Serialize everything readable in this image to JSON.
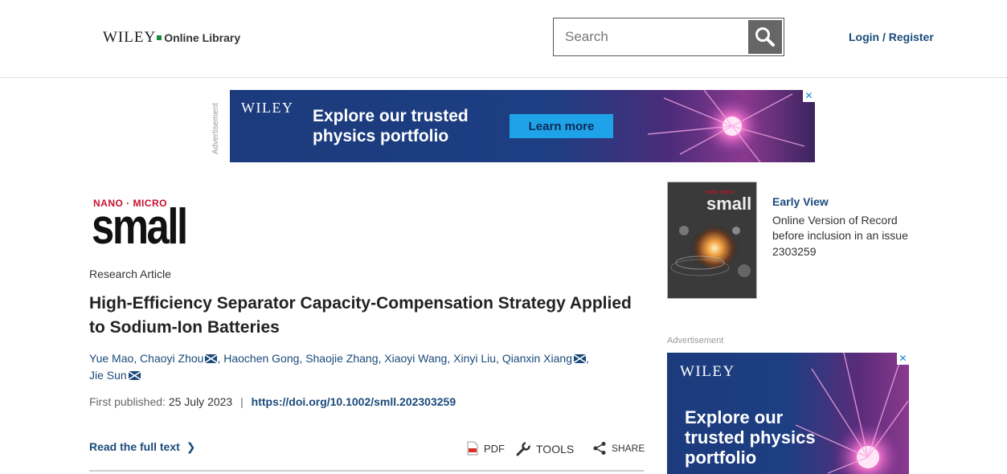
{
  "header": {
    "logo_brand": "WILEY",
    "logo_product": "Online Library",
    "search_placeholder": "Search",
    "login_label": "Login / Register"
  },
  "ad_top": {
    "label": "Advertisement",
    "brand": "WILEY",
    "headline": "Explore our trusted physics portfolio",
    "cta": "Learn more",
    "close": "✕"
  },
  "journal": {
    "prefix": "NANO · MICRO",
    "name": "small"
  },
  "article": {
    "type": "Research Article",
    "title": "High-Efficiency Separator Capacity-Compensation Strategy Applied to Sodium-Ion Batteries",
    "authors": [
      {
        "name": "Yue Mao",
        "corresponding": false
      },
      {
        "name": "Chaoyi Zhou",
        "corresponding": true
      },
      {
        "name": "Haochen Gong",
        "corresponding": false
      },
      {
        "name": "Shaojie Zhang",
        "corresponding": false
      },
      {
        "name": "Xiaoyi Wang",
        "corresponding": false
      },
      {
        "name": "Xinyi Liu",
        "corresponding": false
      },
      {
        "name": "Qianxin Xiang",
        "corresponding": true
      },
      {
        "name": "Jie Sun",
        "corresponding": true
      }
    ],
    "first_published_label": "First published:",
    "first_published_date": "25 July 2023",
    "separator": "|",
    "doi": "https://doi.org/10.1002/smll.202303259",
    "read_full": "Read the full text",
    "tools": {
      "pdf": "PDF",
      "tools": "TOOLS",
      "share": "SHARE"
    }
  },
  "sidebar": {
    "status": "Early View",
    "status_desc": "Online Version of Record before inclusion in an issue",
    "article_number": "2303259",
    "ad_label": "Advertisement",
    "ad_brand": "WILEY",
    "ad_headline": "Explore our trusted physics portfolio",
    "ad_close": "✕"
  },
  "colors": {
    "link": "#1a4a7a",
    "ad_blue": "#1b3b7d",
    "cta_blue": "#1fa3e8",
    "journal_red": "#c8102e"
  }
}
